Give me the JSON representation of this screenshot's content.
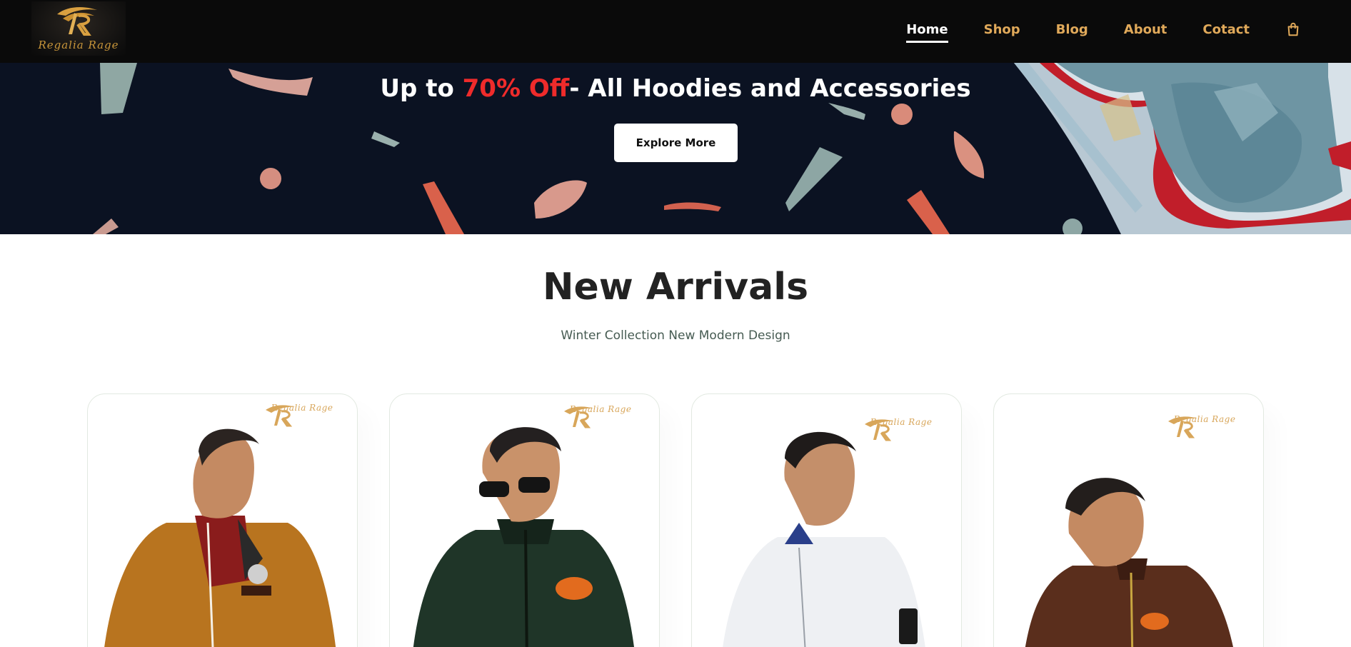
{
  "header": {
    "logo_text": "Regalia Rage",
    "nav": [
      {
        "label": "Home",
        "active": true
      },
      {
        "label": "Shop",
        "active": false
      },
      {
        "label": "Blog",
        "active": false
      },
      {
        "label": "About",
        "active": false
      },
      {
        "label": "Cotact",
        "active": false
      }
    ],
    "cart_icon": "shopping-bag-icon"
  },
  "hero": {
    "title_prefix": "Up to ",
    "title_highlight": "70% Off",
    "title_suffix": "- All Hoodies and Accessories",
    "button_label": "Explore More"
  },
  "arrivals": {
    "title": "New Arrivals",
    "subtitle": "Winter Collection New Modern Design",
    "products": [
      {
        "watermark": "Regalia Rage",
        "jacket_color": "#b8741f"
      },
      {
        "watermark": "Regalia Rage",
        "jacket_color": "#1f3528"
      },
      {
        "watermark": "Regalia Rage",
        "jacket_color": "#eef0f3"
      },
      {
        "watermark": "Regalia Rage",
        "jacket_color": "#5a2e1c"
      }
    ]
  },
  "colors": {
    "header_bg": "#0a0a0a",
    "nav_gold": "#e0a95a",
    "hero_bg": "#0b1222",
    "highlight_red": "#ef2b2b"
  }
}
